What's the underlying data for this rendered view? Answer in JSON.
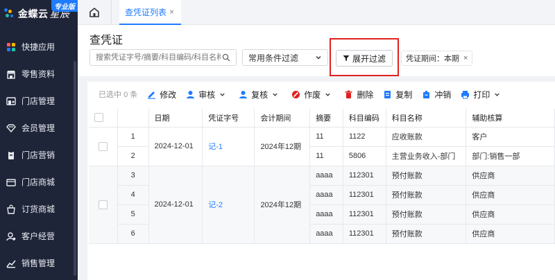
{
  "app": {
    "brand": "金蝶云",
    "brand_sub": "星辰",
    "edition": "专业版"
  },
  "sidebar": {
    "items": [
      {
        "label": "快捷应用",
        "icon": "apps-grid-icon"
      },
      {
        "label": "零售资料",
        "icon": "store-icon"
      },
      {
        "label": "门店管理",
        "icon": "shop-manage-icon"
      },
      {
        "label": "会员管理",
        "icon": "member-icon"
      },
      {
        "label": "门店营销",
        "icon": "marketing-icon"
      },
      {
        "label": "门店商城",
        "icon": "mall-icon"
      },
      {
        "label": "订货商城",
        "icon": "order-mall-icon"
      },
      {
        "label": "客户经营",
        "icon": "customer-icon"
      },
      {
        "label": "销售管理",
        "icon": "sales-icon"
      }
    ]
  },
  "tabs": {
    "active_label": "查凭证列表",
    "close": "×"
  },
  "page": {
    "title": "查凭证",
    "search_placeholder": "搜索凭证字号/摘要/科目编码/科目名称",
    "filter_select": "常用条件过滤",
    "expand_filter": "展开过滤",
    "period_tag": "凭证期间：本期",
    "period_close": "×"
  },
  "toolbar": {
    "selected_prefix": "已选中",
    "selected_count": "0",
    "selected_suffix": "条",
    "edit": "修改",
    "audit": "审核",
    "review": "复核",
    "void": "作废",
    "delete": "删除",
    "copy": "复制",
    "reverse": "冲销",
    "print": "打印"
  },
  "table": {
    "headers": [
      "日期",
      "凭证字号",
      "会计期间",
      "摘要",
      "科目编码",
      "科目名称",
      "辅助核算"
    ],
    "groups": [
      {
        "date": "2024-12-01",
        "voucher": "记-1",
        "period": "2024年12期",
        "rows": [
          {
            "no": "1",
            "summary": "11",
            "code": "1122",
            "name": "应收账款",
            "aux": "客户"
          },
          {
            "no": "2",
            "summary": "11",
            "code": "5806",
            "name": "主营业务收入-部门",
            "aux": "部门:销售一部"
          }
        ]
      },
      {
        "date": "2024-12-01",
        "voucher": "记-2",
        "period": "2024年12期",
        "rows": [
          {
            "no": "3",
            "summary": "aaaa",
            "code": "112301",
            "name": "预付账款",
            "aux": "供应商"
          },
          {
            "no": "4",
            "summary": "aaaa",
            "code": "112301",
            "name": "预付账款",
            "aux": "供应商"
          },
          {
            "no": "5",
            "summary": "aaaa",
            "code": "112301",
            "name": "预付账款",
            "aux": "供应商"
          },
          {
            "no": "6",
            "summary": "aaaa",
            "code": "112301",
            "name": "预付账款",
            "aux": "供应商"
          }
        ]
      }
    ]
  },
  "colors": {
    "sidebar_bg": "#1f2538",
    "accent": "#1f7bff",
    "highlight": "#e02020"
  }
}
